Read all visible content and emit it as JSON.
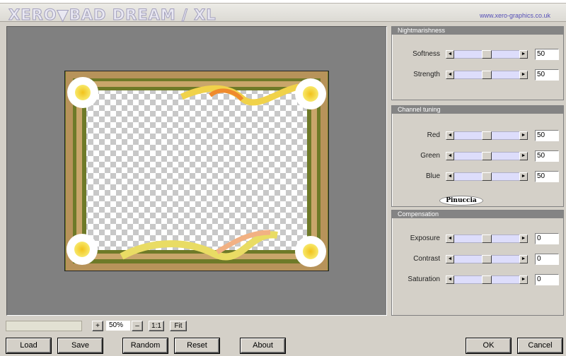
{
  "header": {
    "title": "XERO▼BAD DREAM / XL",
    "url": "www.xero-graphics.co.uk"
  },
  "panels": {
    "nightmarishness": {
      "title": "Nightmarishness",
      "rows": [
        {
          "label": "Softness",
          "value": "50",
          "level": 0.5
        },
        {
          "label": "Strength",
          "value": "50",
          "level": 0.5
        }
      ]
    },
    "channel_tuning": {
      "title": "Channel tuning",
      "rows": [
        {
          "label": "Red",
          "value": "50",
          "level": 0.5
        },
        {
          "label": "Green",
          "value": "50",
          "level": 0.5
        },
        {
          "label": "Blue",
          "value": "50",
          "level": 0.5
        }
      ],
      "signature": "Pinuccia"
    },
    "compensation": {
      "title": "Compensation",
      "rows": [
        {
          "label": "Exposure",
          "value": "0",
          "level": 0.5
        },
        {
          "label": "Contrast",
          "value": "0",
          "level": 0.5
        },
        {
          "label": "Saturation",
          "value": "0",
          "level": 0.5
        }
      ]
    }
  },
  "zoom": {
    "plus": "+",
    "minus": "–",
    "level": "50%",
    "one_to_one": "1:1",
    "fit": "Fit"
  },
  "buttons": {
    "load": "Load",
    "save": "Save",
    "random": "Random",
    "reset": "Reset",
    "about": "About",
    "ok": "OK",
    "cancel": "Cancel"
  },
  "icons": {
    "left": "◄",
    "right": "►"
  },
  "colors": {
    "preview_bg": "#808080",
    "panel_title_bg": "#848484",
    "slider_track": "#ddddfb"
  }
}
